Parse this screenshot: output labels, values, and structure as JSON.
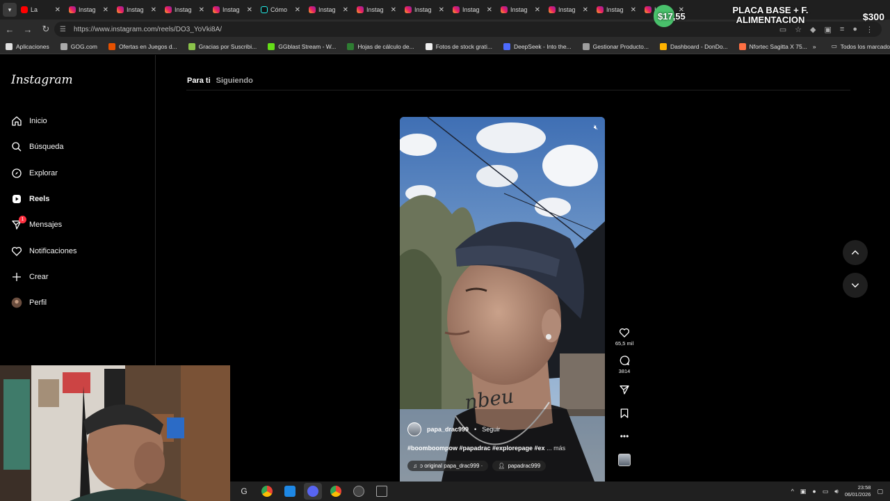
{
  "browser": {
    "tabs": [
      {
        "label": "La",
        "icon": "youtube-icon"
      },
      {
        "label": "Instag",
        "icon": "instagram-icon"
      },
      {
        "label": "Instag",
        "icon": "instagram-icon"
      },
      {
        "label": "Instag",
        "icon": "instagram-icon"
      },
      {
        "label": "Instag",
        "icon": "instagram-icon"
      },
      {
        "label": "Cómo",
        "icon": "tiktok-icon"
      },
      {
        "label": "Instag",
        "icon": "instagram-icon"
      },
      {
        "label": "Instag",
        "icon": "instagram-icon"
      },
      {
        "label": "Instag",
        "icon": "instagram-icon"
      },
      {
        "label": "Instag",
        "icon": "instagram-icon"
      },
      {
        "label": "Instag",
        "icon": "instagram-icon"
      },
      {
        "label": "Instag",
        "icon": "instagram-icon"
      },
      {
        "label": "Instag",
        "icon": "instagram-icon"
      },
      {
        "label": "Instag",
        "icon": "instagram-icon"
      }
    ],
    "url": "https://www.instagram.com/reels/DO3_YoVki8A/",
    "bookmarks": [
      {
        "label": "Aplicaciones",
        "color": "#e0e0e0"
      },
      {
        "label": "GOG.com",
        "color": "#aaaaaa"
      },
      {
        "label": "Ofertas en Juegos d...",
        "color": "#e65100"
      },
      {
        "label": "Gracias por Suscribi...",
        "color": "#8bc34a"
      },
      {
        "label": "GGblast Stream - W...",
        "color": "#64dd17"
      },
      {
        "label": "Hojas de cálculo de...",
        "color": "#2e7d32"
      },
      {
        "label": "Fotos de stock grati...",
        "color": "#eeeeee"
      },
      {
        "label": "DeepSeek - Into the...",
        "color": "#4d6bfe"
      },
      {
        "label": "Gestionar Producto...",
        "color": "#9e9e9e"
      },
      {
        "label": "Dashboard - DonDo...",
        "color": "#ffb300"
      },
      {
        "label": "Nfortec Sagitta X 75...",
        "color": "#ff7043"
      }
    ],
    "all_bookmarks": "Todos los marcadores"
  },
  "overlay": {
    "amount": "$17,55",
    "goal_title_1": "PLACA BASE + F.",
    "goal_title_2": "ALIMENTACION",
    "goal_amount": "$300"
  },
  "instagram": {
    "logo": "Instagram",
    "nav": [
      {
        "label": "Inicio",
        "icon": "home-icon"
      },
      {
        "label": "Búsqueda",
        "icon": "search-icon"
      },
      {
        "label": "Explorar",
        "icon": "compass-icon"
      },
      {
        "label": "Reels",
        "icon": "reels-icon"
      },
      {
        "label": "Mensajes",
        "icon": "messages-icon",
        "badge": "1"
      },
      {
        "label": "Notificaciones",
        "icon": "heart-icon"
      },
      {
        "label": "Crear",
        "icon": "plus-icon"
      },
      {
        "label": "Perfil",
        "icon": "profile-avatar"
      }
    ],
    "feed_tabs": {
      "for_you": "Para ti",
      "following": "Siguiendo"
    },
    "reel": {
      "username": "papa_drac999",
      "separator": "•",
      "follow": "Seguir",
      "caption": "#boomboompow #papadrac #explorepage #ex",
      "more": "... más",
      "audio": "ɔ original  papa_drac999 ·",
      "tagged": "papadrac999",
      "likes": "65,5 mil",
      "comments": "3814"
    }
  },
  "taskbar": {
    "time": "23:58",
    "date": "06/01/2026"
  }
}
